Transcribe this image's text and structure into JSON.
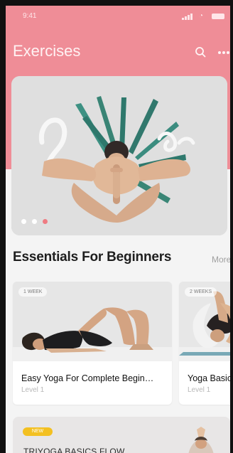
{
  "status_bar": {
    "time": "9:41",
    "signal_icon": "signal-icon",
    "wifi_icon": "wifi-icon",
    "battery_icon": "battery-icon"
  },
  "header": {
    "title": "Exercises",
    "search_icon": "search-icon",
    "more_icon": "more-icon",
    "accent_color": "#ef8d97"
  },
  "hero": {
    "image_alt": "yoga pose over tropical leaves",
    "carousel": {
      "count": 3,
      "active_index": 2,
      "active_color": "#ef7b82"
    }
  },
  "section": {
    "title": "Essentials For Beginners",
    "more_label": "More"
  },
  "cards": [
    {
      "badge": "1 WEEK",
      "title": "Easy Yoga For Complete Begin…",
      "level": "Level 1"
    },
    {
      "badge": "2 WEEKS",
      "title": "Yoga Basic",
      "level": "Level 1"
    }
  ],
  "program": {
    "badge": "NEW",
    "title": "TRIYOGA BASICS FLOW"
  }
}
